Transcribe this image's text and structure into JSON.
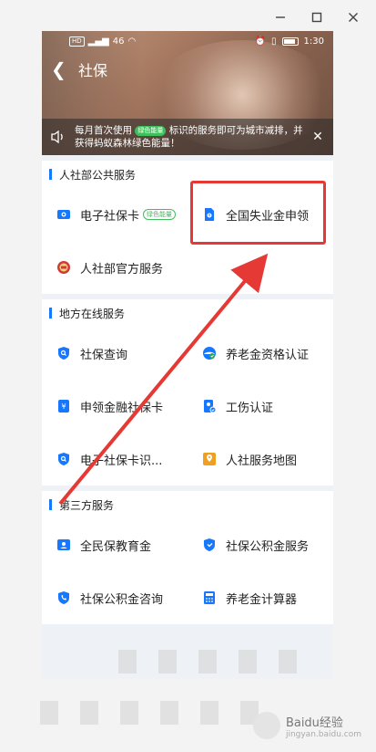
{
  "status_bar": {
    "time": "1:30",
    "hd1": "HD",
    "hd2": "HD",
    "carrier_tag": "46"
  },
  "nav": {
    "title": "社保"
  },
  "notice": {
    "text_before_badge": "每月首次使用",
    "badge": "绿色能量",
    "text_after_badge": "标识的服务即可为城市减排，并获得蚂蚁森林绿色能量！"
  },
  "sections": [
    {
      "title": "人社部公共服务",
      "items": [
        {
          "label": "电子社保卡",
          "badge": "绿色能量",
          "icon": "card-icon",
          "color": "#1677ff"
        },
        {
          "label": "全国失业金申领",
          "badge": "",
          "icon": "document-icon",
          "color": "#1677ff"
        },
        {
          "label": "人社部官方服务",
          "badge": "",
          "icon": "emblem-icon",
          "color": "#d23a3a"
        }
      ]
    },
    {
      "title": "地方在线服务",
      "items": [
        {
          "label": "社保查询",
          "icon": "search-shield-icon",
          "color": "#1677ff"
        },
        {
          "label": "养老金资格认证",
          "icon": "person-check-icon",
          "color": "#1677ff"
        },
        {
          "label": "申领金融社保卡",
          "icon": "yuan-card-icon",
          "color": "#1677ff"
        },
        {
          "label": "工伤认证",
          "icon": "id-check-icon",
          "color": "#1677ff"
        },
        {
          "label": "电子社保卡识...",
          "icon": "search-shield-icon",
          "color": "#1677ff"
        },
        {
          "label": "人社服务地图",
          "icon": "map-icon",
          "color": "#f0a020"
        }
      ]
    },
    {
      "title": "第三方服务",
      "items": [
        {
          "label": "全民保教育金",
          "icon": "person-card-icon",
          "color": "#1677ff"
        },
        {
          "label": "社保公积金服务",
          "icon": "shield-icon",
          "color": "#1677ff"
        },
        {
          "label": "社保公积金咨询",
          "icon": "phone-shield-icon",
          "color": "#1677ff"
        },
        {
          "label": "养老金计算器",
          "icon": "calculator-icon",
          "color": "#1677ff"
        }
      ]
    }
  ],
  "watermark": {
    "text": "Baidu经验",
    "sub": "jingyan.baidu.com"
  },
  "colors": {
    "accent": "#1677ff",
    "highlight": "#e53935",
    "green": "#3fbf5c"
  }
}
